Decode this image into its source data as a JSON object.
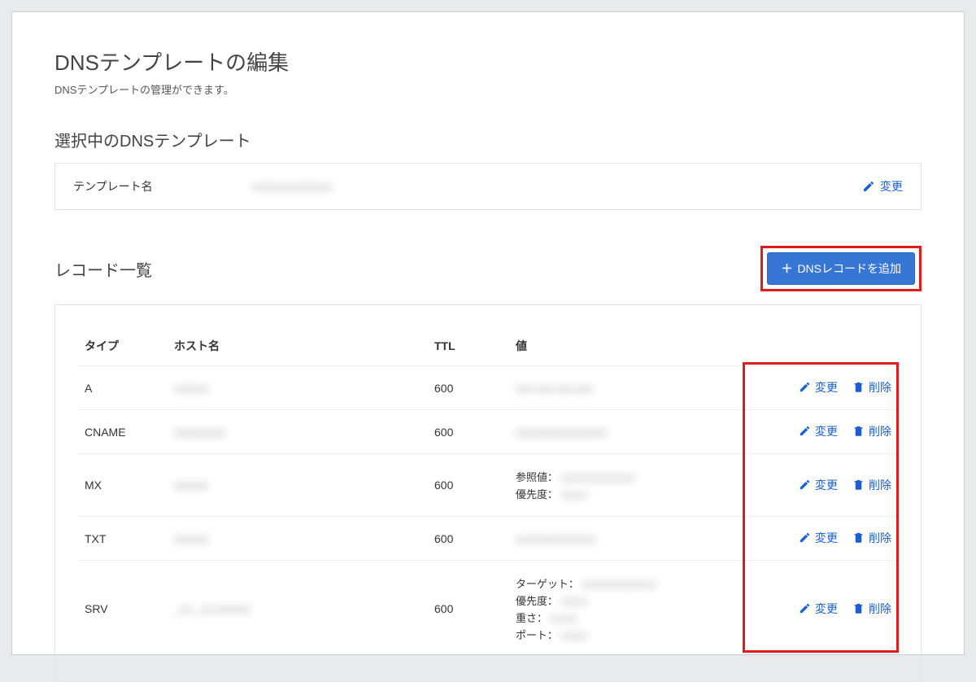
{
  "page": {
    "title": "DNSテンプレートの編集",
    "subtitle": "DNSテンプレートの管理ができます。"
  },
  "selected": {
    "section_title": "選択中のDNSテンプレート",
    "name_label": "テンプレート名",
    "name_value": "xxxxxxxxxxxxxx",
    "edit_label": "変更"
  },
  "records": {
    "section_title": "レコード一覧",
    "add_label": "DNSレコードを追加",
    "headers": {
      "type": "タイプ",
      "host": "ホスト名",
      "ttl": "TTL",
      "value": "値"
    },
    "actions": {
      "edit": "変更",
      "delete": "削除"
    },
    "value_labels": {
      "reference": "参照値：",
      "priority": "優先度：",
      "target": "ターゲット：",
      "weight": "重さ：",
      "port": "ポート："
    },
    "rows": [
      {
        "type": "A",
        "host": "xxxxxx",
        "ttl": "600",
        "value_simple": "xxx.xxx.xxx.xxx"
      },
      {
        "type": "CNAME",
        "host": "xxxxxxxxx",
        "ttl": "600",
        "value_simple": "xxxxxxxxxxxxxxxx"
      },
      {
        "type": "MX",
        "host": "xxxxxx",
        "ttl": "600",
        "value_mx": {
          "reference": "xxxxxxxxxxxxxx",
          "priority": "xxxxx"
        }
      },
      {
        "type": "TXT",
        "host": "xxxxxx",
        "ttl": "600",
        "value_simple": "xxxxxxxxxxxxxx"
      },
      {
        "type": "SRV",
        "host": "_xx._xx.xxxxxx",
        "ttl": "600",
        "value_srv": {
          "target": "xxxxxxxxxxxxxx",
          "priority": "xxxxx",
          "weight": "xxxxx",
          "port": "xxxxx"
        }
      }
    ]
  }
}
